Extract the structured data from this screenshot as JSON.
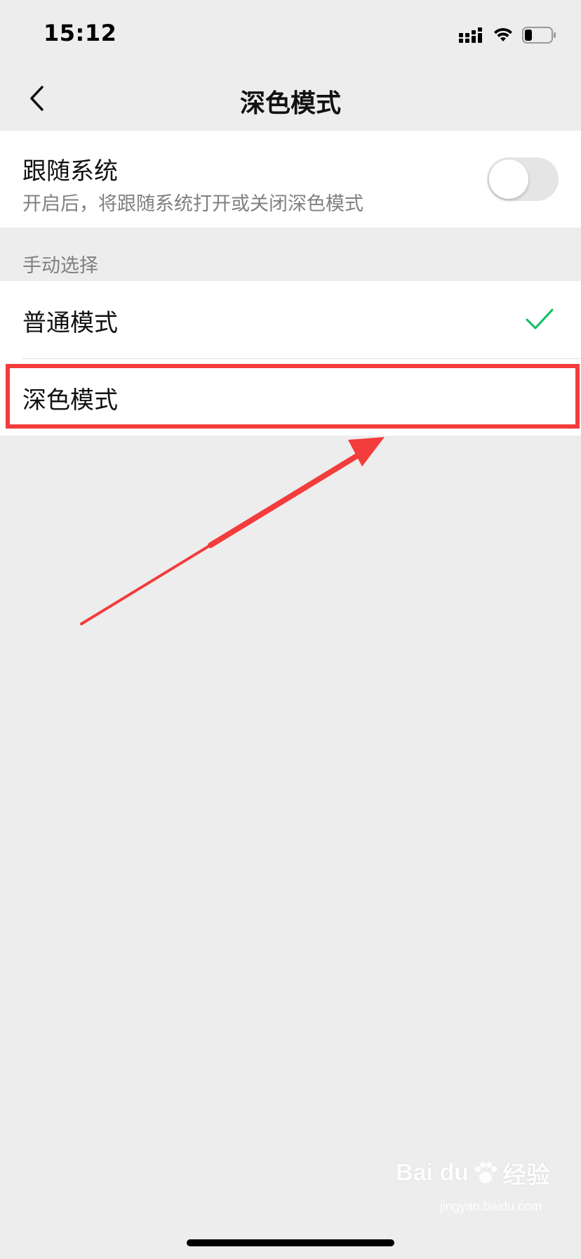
{
  "status_bar": {
    "time": "15:12"
  },
  "nav": {
    "title": "深色模式",
    "back_icon": "chevron-left-icon"
  },
  "follow_system": {
    "title": "跟随系统",
    "description": "开启后，将跟随系统打开或关闭深色模式",
    "enabled": false
  },
  "manual_section": {
    "label": "手动选择",
    "options": [
      {
        "label": "普通模式",
        "selected": true
      },
      {
        "label": "深色模式",
        "selected": false
      }
    ]
  },
  "colors": {
    "background": "#ededed",
    "check": "#07c160",
    "highlight": "#f33c3c"
  },
  "watermark": {
    "brand": "Bai du",
    "suffix": "经验",
    "url": "jingyan.baidu.com"
  }
}
